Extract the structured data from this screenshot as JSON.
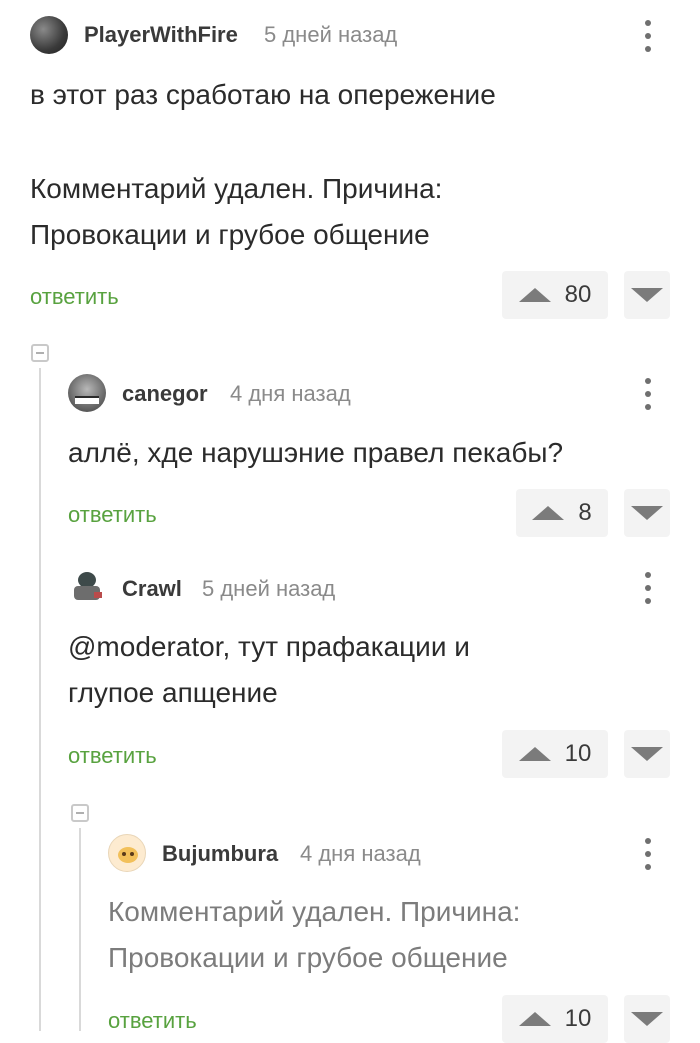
{
  "comments": [
    {
      "username": "PlayerWithFire",
      "time": "5 дней назад",
      "text_lines": [
        "в этот раз сработаю на опережение",
        "",
        "Комментарий удален. Причина:",
        "Провокации и грубое общение"
      ],
      "reply_label": "ответить",
      "rating": "80",
      "avatar_icon": "dark-metal-avatar-icon"
    },
    {
      "username": "canegor",
      "time": "4 дня назад",
      "text_lines": [
        "аллё, хде нарушэние правел пекабы?"
      ],
      "reply_label": "ответить",
      "rating": "8",
      "avatar_icon": "monster-face-avatar-icon"
    },
    {
      "username": "Crawl",
      "time": "5 дней назад",
      "text_lines": [
        "@moderator, тут прафакации и",
        "глупое апщение"
      ],
      "reply_label": "ответить",
      "rating": "10",
      "avatar_icon": "robot-avatar-icon"
    },
    {
      "username": "Bujumbura",
      "time": "4 дня назад",
      "text_lines": [
        "Комментарий удален. Причина:",
        "Провокации и грубое общение"
      ],
      "reply_label": "ответить",
      "rating": "10",
      "avatar_icon": "cat-face-avatar-icon"
    }
  ],
  "colors": {
    "reply_green": "#58a23f",
    "vote_bg": "#f3f3f3",
    "deleted_text": "#7c7c7c"
  }
}
